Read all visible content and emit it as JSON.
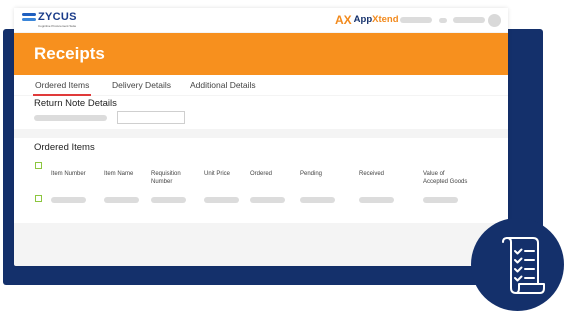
{
  "brand": {
    "logo_text": "ZYCUS",
    "logo_tagline": "Cognitive Procurement Suite",
    "app_x_mark": "AX",
    "app_name_part1": "App",
    "app_name_part2": "Xtend"
  },
  "page": {
    "title": "Receipts"
  },
  "tabs": [
    {
      "label": "Ordered Items",
      "active": true
    },
    {
      "label": "Delivery Details",
      "active": false
    },
    {
      "label": "Additional Details",
      "active": false
    }
  ],
  "return_note": {
    "title": "Return Note Details"
  },
  "ordered_items": {
    "title": "Ordered Items",
    "columns": [
      "Item Number",
      "Item Name",
      "Requisition\nNumber",
      "Unit Price",
      "Ordered",
      "Pending",
      "Received",
      "Value of\nAccepted Goods"
    ]
  },
  "colors": {
    "accent_orange": "#f7901e",
    "navy": "#14306b",
    "tab_underline": "#e03a3a",
    "checkbox_green": "#8cc63f"
  },
  "icons": {
    "corner_icon": "checklist-scroll-icon"
  }
}
